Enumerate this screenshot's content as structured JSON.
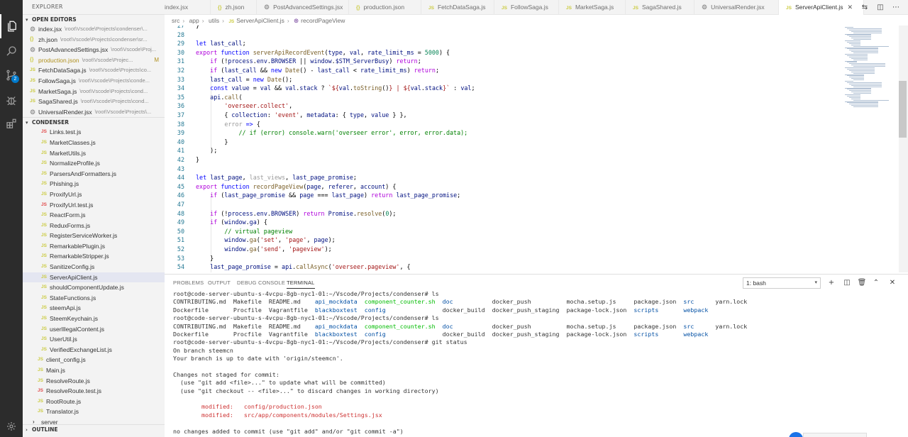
{
  "explorer": {
    "title": "EXPLORER",
    "open_editors_label": "OPEN EDITORS",
    "open_editors": [
      {
        "icon": "dot",
        "name": "index.jsx",
        "path": "\\root\\Vscode\\Projects\\condenser\\..."
      },
      {
        "icon": "json",
        "name": "zh.json",
        "path": "\\root\\Vscode\\Projects\\condenser\\sr..."
      },
      {
        "icon": "dot",
        "name": "PostAdvancedSettings.jsx",
        "path": "\\root\\Vscode\\Proj..."
      },
      {
        "icon": "json",
        "name": "production.json",
        "path": "\\root\\Vscode\\Projec...",
        "status": "M"
      },
      {
        "icon": "js",
        "name": "FetchDataSaga.js",
        "path": "\\root\\Vscode\\Projects\\co..."
      },
      {
        "icon": "js",
        "name": "FollowSaga.js",
        "path": "\\root\\Vscode\\Projects\\conde..."
      },
      {
        "icon": "js",
        "name": "MarketSaga.js",
        "path": "\\root\\Vscode\\Projects\\cond..."
      },
      {
        "icon": "js",
        "name": "SagaShared.js",
        "path": "\\root\\Vscode\\Projects\\cond..."
      },
      {
        "icon": "dot",
        "name": "UniversalRender.jsx",
        "path": "\\root\\Vscode\\Projects\\..."
      }
    ],
    "project_label": "CONDENSER",
    "files": [
      {
        "icon": "test",
        "name": "Links.test.js",
        "indent": 1
      },
      {
        "icon": "js",
        "name": "MarketClasses.js",
        "indent": 1
      },
      {
        "icon": "js",
        "name": "MarketUtils.js",
        "indent": 1
      },
      {
        "icon": "js",
        "name": "NormalizeProfile.js",
        "indent": 1
      },
      {
        "icon": "js",
        "name": "ParsersAndFormatters.js",
        "indent": 1
      },
      {
        "icon": "js",
        "name": "Phishing.js",
        "indent": 1
      },
      {
        "icon": "js",
        "name": "ProxifyUrl.js",
        "indent": 1
      },
      {
        "icon": "test",
        "name": "ProxifyUrl.test.js",
        "indent": 1
      },
      {
        "icon": "js",
        "name": "ReactForm.js",
        "indent": 1
      },
      {
        "icon": "js",
        "name": "ReduxForms.js",
        "indent": 1
      },
      {
        "icon": "js",
        "name": "RegisterServiceWorker.js",
        "indent": 1
      },
      {
        "icon": "js",
        "name": "RemarkablePlugin.js",
        "indent": 1
      },
      {
        "icon": "js",
        "name": "RemarkableStripper.js",
        "indent": 1
      },
      {
        "icon": "js",
        "name": "SanitizeConfig.js",
        "indent": 1
      },
      {
        "icon": "js",
        "name": "ServerApiClient.js",
        "indent": 1,
        "selected": true
      },
      {
        "icon": "js",
        "name": "shouldComponentUpdate.js",
        "indent": 1
      },
      {
        "icon": "js",
        "name": "StateFunctions.js",
        "indent": 1
      },
      {
        "icon": "js",
        "name": "steemApi.js",
        "indent": 1
      },
      {
        "icon": "js",
        "name": "SteemKeychain.js",
        "indent": 1
      },
      {
        "icon": "js",
        "name": "userIllegalContent.js",
        "indent": 1
      },
      {
        "icon": "js",
        "name": "UserUtil.js",
        "indent": 1
      },
      {
        "icon": "js",
        "name": "VerifiedExchangeList.js",
        "indent": 1
      },
      {
        "icon": "js",
        "name": "client_config.js",
        "indent": 0
      },
      {
        "icon": "js",
        "name": "Main.js",
        "indent": 0
      },
      {
        "icon": "js",
        "name": "ResolveRoute.js",
        "indent": 0
      },
      {
        "icon": "test",
        "name": "ResolveRoute.test.js",
        "indent": 0
      },
      {
        "icon": "js",
        "name": "RootRoute.js",
        "indent": 0
      },
      {
        "icon": "js",
        "name": "Translator.js",
        "indent": 0
      },
      {
        "icon": "folder",
        "name": "server",
        "indent": -1
      }
    ],
    "outline_label": "OUTLINE"
  },
  "tabs": [
    {
      "icon": "dot",
      "label": "index.jsx"
    },
    {
      "icon": "json",
      "label": "zh.json"
    },
    {
      "icon": "dot",
      "label": "PostAdvancedSettings.jsx"
    },
    {
      "icon": "json",
      "label": "production.json"
    },
    {
      "icon": "js",
      "label": "FetchDataSaga.js"
    },
    {
      "icon": "js",
      "label": "FollowSaga.js"
    },
    {
      "icon": "js",
      "label": "MarketSaga.js"
    },
    {
      "icon": "js",
      "label": "SagaShared.js"
    },
    {
      "icon": "dot",
      "label": "UniversalRender.jsx"
    },
    {
      "icon": "js",
      "label": "ServerApiClient.js",
      "active": true
    }
  ],
  "breadcrumb": {
    "parts": [
      "src",
      "app",
      "utils",
      "ServerApiClient.js",
      "recordPageView"
    ]
  },
  "code_lines": [
    {
      "n": "27",
      "html": "}"
    },
    {
      "n": "28",
      "html": ""
    },
    {
      "n": "29",
      "html": "<span class=\"k\">let</span> <span class=\"v\">last_call</span>;"
    },
    {
      "n": "30",
      "html": "<span class=\"kf\">export</span> <span class=\"k\">function</span> <span class=\"fn\">serverApiRecordEvent</span>(<span class=\"v\">type</span>, <span class=\"v\">val</span>, <span class=\"v\">rate_limit_ms</span> = <span class=\"n\">5000</span>) {"
    },
    {
      "n": "31",
      "html": "    <span class=\"kf\">if</span> (!<span class=\"v\">process</span>.<span class=\"v\">env</span>.<span class=\"v\">BROWSER</span> || <span class=\"v\">window</span>.<span class=\"v\">$STM_ServerBusy</span>) <span class=\"kf\">return</span>;"
    },
    {
      "n": "32",
      "html": "    <span class=\"kf\">if</span> (<span class=\"v\">last_call</span> &amp;&amp; <span class=\"k\">new</span> <span class=\"fn\">Date</span>() - <span class=\"v\">last_call</span> &lt; <span class=\"v\">rate_limit_ms</span>) <span class=\"kf\">return</span>;"
    },
    {
      "n": "33",
      "html": "    <span class=\"v\">last_call</span> = <span class=\"k\">new</span> <span class=\"fn\">Date</span>();"
    },
    {
      "n": "34",
      "html": "    <span class=\"k\">const</span> <span class=\"v\">value</span> = <span class=\"v\">val</span> &amp;&amp; <span class=\"v\">val</span>.<span class=\"v\">stack</span> ? <span class=\"s\">`${</span><span class=\"v\">val</span>.<span class=\"fn\">toString</span>()<span class=\"s\">} | ${</span><span class=\"v\">val</span>.<span class=\"v\">stack</span><span class=\"s\">}`</span> : <span class=\"v\">val</span>;"
    },
    {
      "n": "35",
      "html": "    <span class=\"v\">api</span>.<span class=\"fn\">call</span>("
    },
    {
      "n": "36",
      "html": "        <span class=\"s\">'overseer.collect'</span>,"
    },
    {
      "n": "37",
      "html": "        { <span class=\"v\">collection</span>: <span class=\"s\">'event'</span>, <span class=\"v\">metadata</span>: { <span class=\"v\">type</span>, <span class=\"v\">value</span> } },"
    },
    {
      "n": "38",
      "html": "        <span class=\"dim\">error</span> <span class=\"k\">=&gt;</span> {"
    },
    {
      "n": "39",
      "html": "            <span class=\"c\">// if (error) console.warn('overseer error', error, error.data);</span>"
    },
    {
      "n": "40",
      "html": "        }"
    },
    {
      "n": "41",
      "html": "    );"
    },
    {
      "n": "42",
      "html": "}"
    },
    {
      "n": "43",
      "html": ""
    },
    {
      "n": "44",
      "html": "<span class=\"k\">let</span> <span class=\"v\">last_page</span>, <span class=\"dim\">last_views</span>, <span class=\"v\">last_page_promise</span>;"
    },
    {
      "n": "45",
      "html": "<span class=\"kf\">export</span> <span class=\"k\">function</span> <span class=\"fn\">recordPageView</span>(<span class=\"v\">page</span>, <span class=\"v\">referer</span>, <span class=\"v\">account</span>) {"
    },
    {
      "n": "46",
      "html": "    <span class=\"kf\">if</span> (<span class=\"v\">last_page_promise</span> &amp;&amp; <span class=\"v\">page</span> === <span class=\"v\">last_page</span>) <span class=\"kf\">return</span> <span class=\"v\">last_page_promise</span>;"
    },
    {
      "n": "47",
      "html": ""
    },
    {
      "n": "48",
      "html": "    <span class=\"kf\">if</span> (!<span class=\"v\">process</span>.<span class=\"v\">env</span>.<span class=\"v\">BROWSER</span>) <span class=\"kf\">return</span> <span class=\"v\">Promise</span>.<span class=\"fn\">resolve</span>(<span class=\"n\">0</span>);"
    },
    {
      "n": "49",
      "html": "    <span class=\"kf\">if</span> (<span class=\"v\">window</span>.<span class=\"v\">ga</span>) {"
    },
    {
      "n": "50",
      "html": "        <span class=\"c\">// virtual pageview</span>"
    },
    {
      "n": "51",
      "html": "        <span class=\"v\">window</span>.<span class=\"fn\">ga</span>(<span class=\"s\">'set'</span>, <span class=\"s\">'page'</span>, <span class=\"v\">page</span>);"
    },
    {
      "n": "52",
      "html": "        <span class=\"v\">window</span>.<span class=\"fn\">ga</span>(<span class=\"s\">'send'</span>, <span class=\"s\">'pageview'</span>);"
    },
    {
      "n": "53",
      "html": "    }"
    },
    {
      "n": "54",
      "html": "    <span class=\"v\">last_page_promise</span> = <span class=\"v\">api</span>.<span class=\"fn\">callAsync</span>(<span class=\"s\">'overseer.pageview'</span>, {"
    }
  ],
  "panel": {
    "tabs": [
      "PROBLEMS",
      "OUTPUT",
      "DEBUG CONSOLE",
      "TERMINAL"
    ],
    "active_tab": "TERMINAL",
    "terminal_select": "1: bash"
  },
  "terminal_lines": [
    "root@code-server-ubuntu-s-4vcpu-8gb-nyc1-01:~/Vscode/Projects/condenser# ls",
    "CONTRIBUTING.md  Makefile  README.md    <span class=\"t-blue\">api_mockdata</span>  <span class=\"t-green\">component_counter.sh</span>  <span class=\"t-blue\">doc</span>           docker_push          mocha.setup.js     package.json  <span class=\"t-blue\">src</span>      yarn.lock",
    "Dockerfile       Procfile  Vagrantfile  <span class=\"t-blue\">blackboxtest</span>  <span class=\"t-blue\">config</span>                docker_build  docker_push_staging  package-lock.json  <span class=\"t-blue\">scripts</span>       <span class=\"t-blue\">webpack</span>",
    "root@code-server-ubuntu-s-4vcpu-8gb-nyc1-01:~/Vscode/Projects/condenser# ls",
    "CONTRIBUTING.md  Makefile  README.md    <span class=\"t-blue\">api_mockdata</span>  <span class=\"t-green\">component_counter.sh</span>  <span class=\"t-blue\">doc</span>           docker_push          mocha.setup.js     package.json  <span class=\"t-blue\">src</span>      yarn.lock",
    "Dockerfile       Procfile  Vagrantfile  <span class=\"t-blue\">blackboxtest</span>  <span class=\"t-blue\">config</span>                docker_build  docker_push_staging  package-lock.json  <span class=\"t-blue\">scripts</span>       <span class=\"t-blue\">webpack</span>",
    "root@code-server-ubuntu-s-4vcpu-8gb-nyc1-01:~/Vscode/Projects/condenser# git status",
    "On branch steemcn",
    "Your branch is up to date with 'origin/steemcn'.",
    "",
    "Changes not staged for commit:",
    "  (use \"git add &lt;file&gt;...\" to update what will be committed)",
    "  (use \"git checkout -- &lt;file&gt;...\" to discard changes in working directory)",
    "",
    "        <span class=\"t-red\">modified:   config/production.json</span>",
    "        <span class=\"t-red\">modified:   src/app/components/modules/Settings.jsx</span>",
    "",
    "no changes added to commit (use \"git add\" and/or \"git commit -a\")"
  ],
  "colors": {
    "activity_bar": "#2c2c2c",
    "sidebar": "#f3f3f3",
    "accent": "#007acc",
    "js_icon": "#cbcb41",
    "modified": "#b0901e"
  },
  "activity": {
    "scm_badge": "2"
  }
}
